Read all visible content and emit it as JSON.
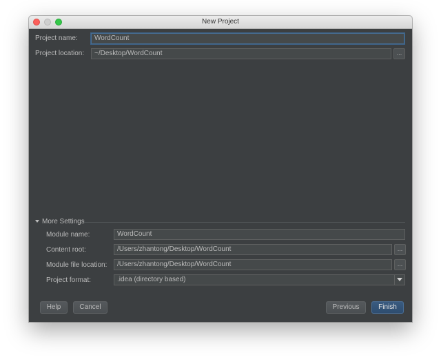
{
  "window": {
    "title": "New Project"
  },
  "project": {
    "name_label": "Project name:",
    "name_value": "WordCount",
    "location_label": "Project location:",
    "location_value": "~/Desktop/WordCount",
    "browse_label": "..."
  },
  "more_settings": {
    "toggle_label": "More Settings",
    "module_name_label": "Module name:",
    "module_name_value": "WordCount",
    "content_root_label": "Content root:",
    "content_root_value": "/Users/zhantong/Desktop/WordCount",
    "module_file_label": "Module file location:",
    "module_file_value": "/Users/zhantong/Desktop/WordCount",
    "format_label": "Project format:",
    "format_value": ".idea (directory based)",
    "browse_label": "..."
  },
  "buttons": {
    "help": "Help",
    "cancel": "Cancel",
    "previous": "Previous",
    "finish": "Finish"
  },
  "icons": {
    "close": "close-traffic-light",
    "minimize": "minimize-traffic-light",
    "maximize": "maximize-traffic-light",
    "expand": "triangle-down-icon",
    "dropdown": "chevron-down-icon"
  },
  "colors": {
    "window_bg": "#3c3f41",
    "field_bg": "#45494a",
    "accent": "#466d94",
    "primary_button": "#365880"
  }
}
